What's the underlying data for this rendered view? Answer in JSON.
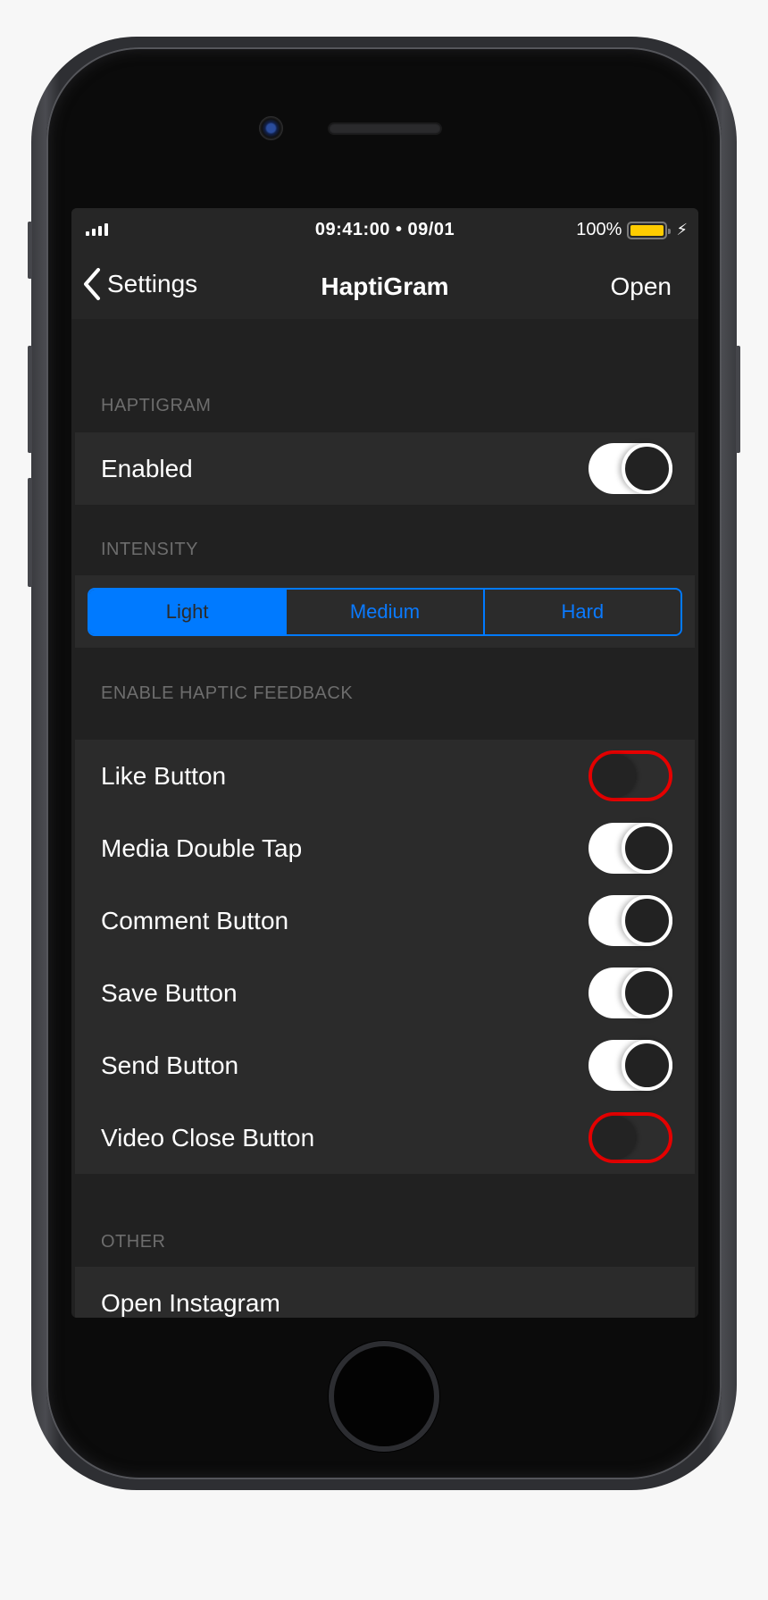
{
  "status_bar": {
    "signal_bars": 4,
    "time_date": "09:41:00 • 09/01",
    "battery_percent": "100%",
    "battery_level": 1.0,
    "battery_color": "#ffcc00",
    "charging_icon": "⚡"
  },
  "nav": {
    "back_label": "Settings",
    "title": "HaptiGram",
    "action_label": "Open"
  },
  "sections": {
    "haptigram": {
      "header": "HAPTIGRAM",
      "rows": [
        {
          "label": "Enabled",
          "toggle": true
        }
      ]
    },
    "intensity": {
      "header": "INTENSITY",
      "options": [
        "Light",
        "Medium",
        "Hard"
      ],
      "selected": "Light"
    },
    "feedback": {
      "header": "ENABLE HAPTIC FEEDBACK",
      "rows": [
        {
          "label": "Like Button",
          "toggle": false
        },
        {
          "label": "Media Double Tap",
          "toggle": true
        },
        {
          "label": "Comment Button",
          "toggle": true
        },
        {
          "label": "Save Button",
          "toggle": true
        },
        {
          "label": "Send Button",
          "toggle": true
        },
        {
          "label": "Video Close Button",
          "toggle": false
        }
      ]
    },
    "other": {
      "header": "OTHER",
      "rows": [
        {
          "label": "Open Instagram"
        }
      ]
    }
  },
  "colors": {
    "accent": "#007aff",
    "toggle_off_border": "#e60000",
    "background": "#212121",
    "cell": "#2b2b2b"
  }
}
